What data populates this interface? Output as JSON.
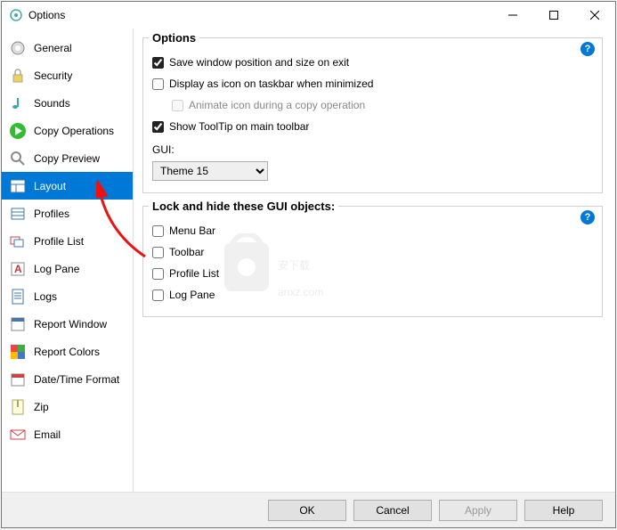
{
  "window": {
    "title": "Options"
  },
  "sidebar": {
    "items": [
      {
        "label": "General"
      },
      {
        "label": "Security"
      },
      {
        "label": "Sounds"
      },
      {
        "label": "Copy Operations"
      },
      {
        "label": "Copy Preview"
      },
      {
        "label": "Layout"
      },
      {
        "label": "Profiles"
      },
      {
        "label": "Profile List"
      },
      {
        "label": "Log Pane"
      },
      {
        "label": "Logs"
      },
      {
        "label": "Report Window"
      },
      {
        "label": "Report Colors"
      },
      {
        "label": "Date/Time Format"
      },
      {
        "label": "Zip"
      },
      {
        "label": "Email"
      }
    ],
    "selected_index": 5
  },
  "options_group": {
    "title": "Options",
    "save_position": {
      "label": "Save window position and size on exit",
      "checked": true
    },
    "display_icon": {
      "label": "Display as icon on taskbar when minimized",
      "checked": false
    },
    "animate_icon": {
      "label": "Animate icon during a copy operation",
      "checked": false,
      "disabled": true
    },
    "show_tooltip": {
      "label": "Show ToolTip on main toolbar",
      "checked": true
    },
    "gui_label": "GUI:",
    "gui_value": "Theme 15"
  },
  "lock_group": {
    "title": "Lock and hide these GUI objects:",
    "menu_bar": {
      "label": "Menu Bar",
      "checked": false
    },
    "toolbar": {
      "label": "Toolbar",
      "checked": false
    },
    "profile_list": {
      "label": "Profile List",
      "checked": false
    },
    "log_pane": {
      "label": "Log Pane",
      "checked": false
    }
  },
  "footer": {
    "ok": "OK",
    "cancel": "Cancel",
    "apply": "Apply",
    "help": "Help"
  },
  "watermark": {
    "text": "安下载",
    "domain": "anxz.com"
  }
}
